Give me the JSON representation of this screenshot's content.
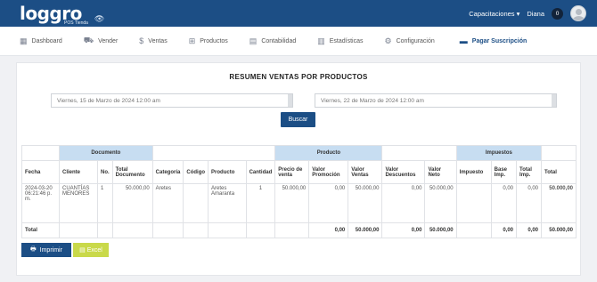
{
  "brand": {
    "logo_text": "loggro",
    "sub": "POS Tienda"
  },
  "topbar": {
    "training": "Capacitaciones ▾",
    "user": "Diana",
    "notifications": "0"
  },
  "nav": [
    {
      "label": "Dashboard",
      "icon": "dashboard-icon"
    },
    {
      "label": "Vender",
      "icon": "cart-icon"
    },
    {
      "label": "Ventas",
      "icon": "dollar-icon"
    },
    {
      "label": "Productos",
      "icon": "basket-icon"
    },
    {
      "label": "Contabilidad",
      "icon": "ledger-icon"
    },
    {
      "label": "Estadísticas",
      "icon": "bar-chart-icon"
    },
    {
      "label": "Configuración",
      "icon": "settings-icon"
    },
    {
      "label": "Pagar Suscripción",
      "icon": "credit-card-icon"
    }
  ],
  "report": {
    "title": "RESUMEN VENTAS POR PRODUCTOS",
    "date_from": "Viernes, 15 de Marzo de 2024 12:00 am",
    "date_to": "Viernes, 22 de Marzo de 2024 12:00 am",
    "search_label": "Buscar"
  },
  "table": {
    "groups": {
      "documento": "Documento",
      "producto": "Producto",
      "impuestos": "Impuestos"
    },
    "headers": [
      "Fecha",
      "Cliente",
      "No.",
      "Total Documento",
      "Categoría",
      "Código",
      "Producto",
      "Cantidad",
      "Precio de venta",
      "Valor Promoción",
      "Valor Ventas",
      "Valor Descuentos",
      "Valor Neto",
      "Impuesto",
      "Base Imp.",
      "Total Imp.",
      "Total"
    ],
    "row": [
      "2024-03-20 06:21:46 p. m.",
      "CUANTÍAS MENORES",
      "1",
      "50.000,00",
      "Aretes",
      "",
      "Aretes Amaranta",
      "1",
      "50.000,00",
      "0,00",
      "50.000,00",
      "0,00",
      "50.000,00",
      "",
      "0,00",
      "0,00",
      "50.000,00"
    ],
    "total": [
      "Total",
      "",
      "",
      "",
      "",
      "",
      "",
      "",
      "",
      "0,00",
      "50.000,00",
      "0,00",
      "50.000,00",
      "",
      "0,00",
      "0,00",
      "50.000,00"
    ]
  },
  "actions": {
    "print": "Imprimir",
    "excel": "Excel"
  }
}
